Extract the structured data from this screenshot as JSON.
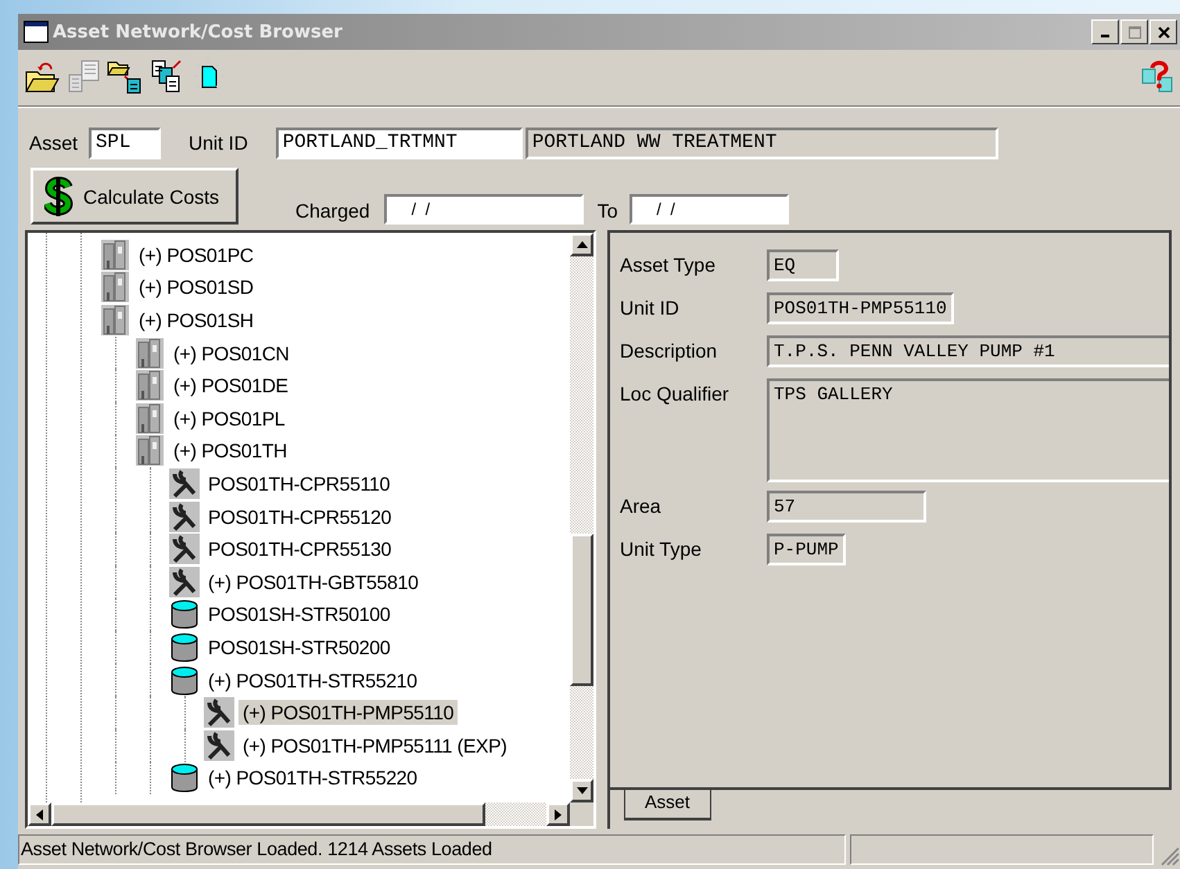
{
  "window": {
    "title": "Asset Network/Cost Browser"
  },
  "header": {
    "asset_label": "Asset",
    "asset_value": "SPL",
    "unit_id_label": "Unit ID",
    "unit_id_value": "PORTLAND_TRTMNT",
    "unit_description": "PORTLAND WW TREATMENT",
    "calculate_button": "Calculate Costs",
    "charged_label": "Charged",
    "charged_value": "/  /",
    "to_label": "To",
    "to_value": "/  /"
  },
  "tree": [
    {
      "label": "(+) POS01PC",
      "kind": "building",
      "selected": false
    },
    {
      "label": "(+) POS01SD",
      "kind": "building",
      "selected": false
    },
    {
      "label": "(+) POS01SH",
      "kind": "building",
      "selected": false,
      "children": [
        {
          "label": "(+) POS01CN",
          "kind": "building",
          "selected": false
        },
        {
          "label": "(+) POS01DE",
          "kind": "building",
          "selected": false
        },
        {
          "label": "(+) POS01PL",
          "kind": "building",
          "selected": false
        },
        {
          "label": "(+) POS01TH",
          "kind": "building",
          "selected": false,
          "children": [
            {
              "label": "POS01TH-CPR55110",
              "kind": "wrench",
              "selected": false
            },
            {
              "label": "POS01TH-CPR55120",
              "kind": "wrench",
              "selected": false
            },
            {
              "label": "POS01TH-CPR55130",
              "kind": "wrench",
              "selected": false
            },
            {
              "label": "(+) POS01TH-GBT55810",
              "kind": "wrench",
              "selected": false
            },
            {
              "label": "POS01SH-STR50100",
              "kind": "tank",
              "selected": false
            },
            {
              "label": "POS01SH-STR50200",
              "kind": "tank",
              "selected": false
            },
            {
              "label": "(+) POS01TH-STR55210",
              "kind": "tank",
              "selected": false,
              "children": [
                {
                  "label": "(+) POS01TH-PMP55110",
                  "kind": "wrench",
                  "selected": true
                },
                {
                  "label": "(+) POS01TH-PMP55111 (EXP)",
                  "kind": "wrench",
                  "selected": false
                }
              ]
            },
            {
              "label": "(+) POS01TH-STR55220",
              "kind": "tank",
              "selected": false
            }
          ]
        }
      ]
    }
  ],
  "details": {
    "fields": [
      {
        "label": "Asset Type",
        "value": "EQ",
        "kind": "short"
      },
      {
        "label": "Unit ID",
        "value": "POS01TH-PMP55110",
        "kind": "medium"
      },
      {
        "label": "Description",
        "value": "T.P.S. PENN VALLEY PUMP #1",
        "kind": "wide"
      },
      {
        "label": "Loc Qualifier",
        "value": "TPS GALLERY",
        "kind": "memo"
      },
      {
        "label": "Area",
        "value": "57",
        "kind": "medium"
      },
      {
        "label": "Unit Type",
        "value": "P-PUMP",
        "kind": "short"
      }
    ],
    "tabs": [
      {
        "label": "Asset",
        "selected": true
      }
    ]
  },
  "status_bar": {
    "message": "Asset Network/Cost Browser Loaded. 1214 Assets Loaded"
  }
}
